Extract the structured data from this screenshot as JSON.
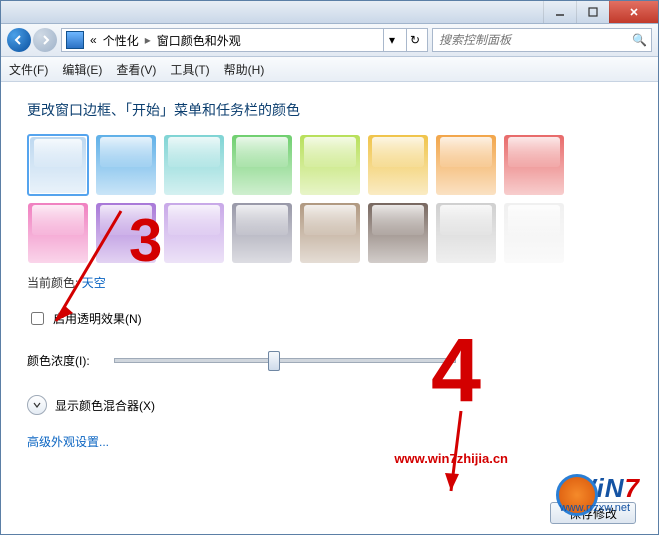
{
  "titlebar": {
    "min": "–",
    "max": "☐",
    "close": "✕"
  },
  "nav": {
    "breadcrumb_prefix": "«",
    "breadcrumb_1": "个性化",
    "breadcrumb_2": "窗口颜色和外观",
    "search_placeholder": "搜索控制面板"
  },
  "menu": {
    "file": "文件(F)",
    "edit": "编辑(E)",
    "view": "查看(V)",
    "tools": "工具(T)",
    "help": "帮助(H)"
  },
  "heading": "更改窗口边框、「开始」菜单和任务栏的颜色",
  "swatches": [
    {
      "name": "天空",
      "color": "#bdd8f0",
      "selected": true
    },
    {
      "name": "c2",
      "color": "#5fb0e8"
    },
    {
      "name": "c3",
      "color": "#7fd4d4"
    },
    {
      "name": "c4",
      "color": "#6fcf6f"
    },
    {
      "name": "c5",
      "color": "#b8e05a"
    },
    {
      "name": "c6",
      "color": "#f0c44a"
    },
    {
      "name": "c7",
      "color": "#f2a54a"
    },
    {
      "name": "c8",
      "color": "#e86a6a"
    },
    {
      "name": "c9",
      "color": "#f080c0"
    },
    {
      "name": "c10",
      "color": "#a878d8"
    },
    {
      "name": "c11",
      "color": "#c8a8e8"
    },
    {
      "name": "c12",
      "color": "#9898a8"
    },
    {
      "name": "c13",
      "color": "#b09880"
    },
    {
      "name": "c14",
      "color": "#786860"
    },
    {
      "name": "c15",
      "color": "#d0d0d0"
    },
    {
      "name": "c16",
      "color": "#f0f0f0"
    }
  ],
  "current_color_label": "当前颜色:",
  "current_color_value": "天空",
  "enable_transparency": "启用透明效果(N)",
  "intensity_label": "颜色浓度(I):",
  "mixer_label": "显示颜色混合器(X)",
  "advanced_link": "高级外观设置...",
  "save_btn": "保存修改",
  "watermark_url": "www.win7zhijia.cn",
  "watermark_logo": "WiN",
  "watermark_seven": "7",
  "watermark_site": "www.rrzxw.net",
  "annotations": {
    "three": "3",
    "four": "4"
  }
}
